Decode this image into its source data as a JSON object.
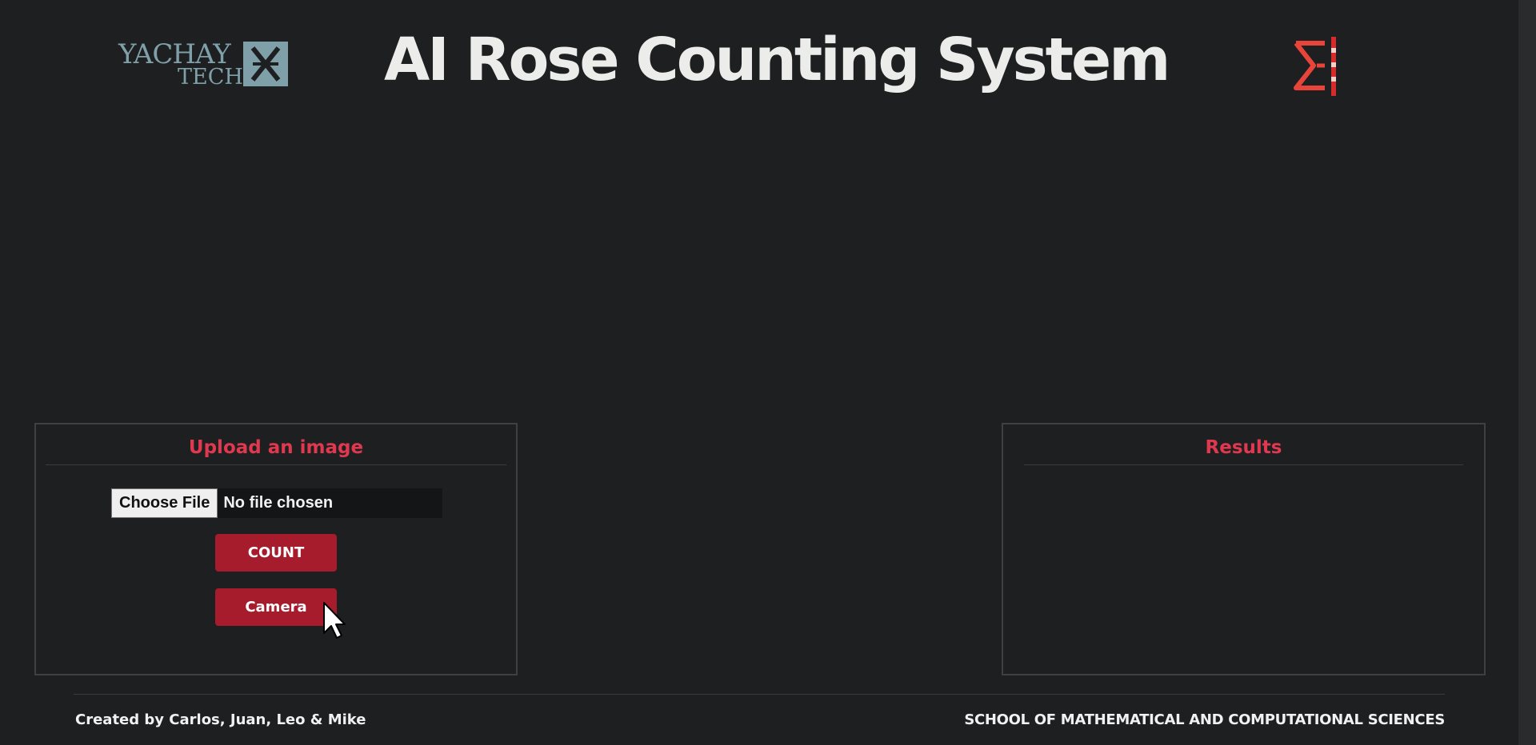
{
  "header": {
    "title": "AI Rose Counting System",
    "logo_left": {
      "line1": "YACHAY",
      "line2": "TECH",
      "icon": "yachay-tech-logo-icon",
      "color": "#7fa0a8"
    },
    "logo_right": {
      "icon": "sigma-logo-icon",
      "color": "#e8443a"
    }
  },
  "upload_panel": {
    "title": "Upload an image",
    "file_input": {
      "button_label": "Choose File",
      "status": "No file chosen"
    },
    "count_button": "COUNT",
    "camera_button": "Camera"
  },
  "results_panel": {
    "title": "Results"
  },
  "footer": {
    "credit": "Created by Carlos, Juan, Leo & Mike",
    "school": "SCHOOL OF MATHEMATICAL AND COMPUTATIONAL SCIENCES"
  },
  "colors": {
    "background": "#1e1f21",
    "accent": "#e0394f",
    "button": "#a71c2c",
    "title_text": "#ececea"
  }
}
